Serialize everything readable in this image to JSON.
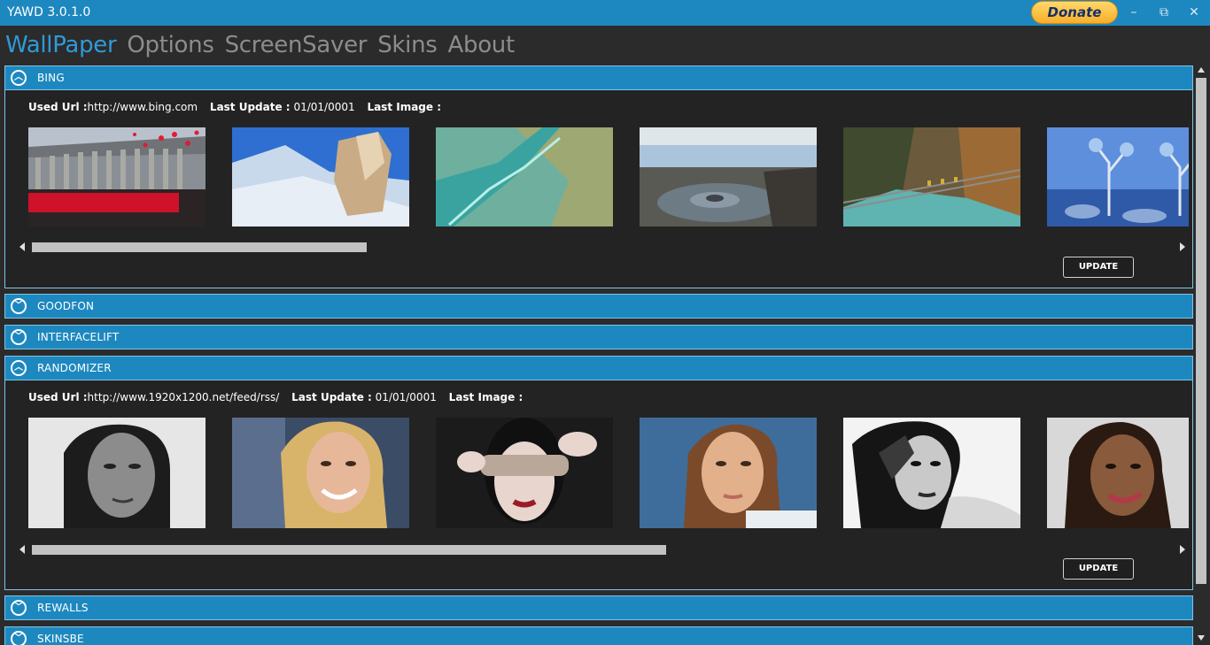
{
  "window": {
    "title": "YAWD 3.0.1.0",
    "donate_label": "Donate",
    "minimize": "–",
    "restore": "⧉",
    "close": "✕"
  },
  "nav": {
    "items": [
      "WallPaper",
      "Options",
      "ScreenSaver",
      "Skins",
      "About"
    ],
    "active": "WallPaper"
  },
  "labels": {
    "used_url": "Used Url :",
    "last_update": "Last Update :",
    "last_image": "Last Image :",
    "update": "UPDATE"
  },
  "panels": [
    {
      "name": "BING",
      "expanded": true,
      "url": "http://www.bing.com",
      "last_update": "01/01/0001",
      "scroll_fraction": 0.29,
      "thumbnails": [
        "cathedral-crowd-balloons",
        "snowy-mountain-rock",
        "aerial-river-delta",
        "mud-volcano-landscape",
        "rope-bridge-autumn-gorge",
        "blue-tinted-trees"
      ]
    },
    {
      "name": "GOODFON",
      "expanded": false
    },
    {
      "name": "INTERFACELIFT",
      "expanded": false
    },
    {
      "name": "RANDOMIZER",
      "expanded": true,
      "url": "http://www.1920x1200.net/feed/rss/",
      "last_update": "01/01/0001",
      "scroll_fraction": 0.54,
      "thumbnails": [
        "bw-portrait-woman",
        "smiling-blonde-woman",
        "woman-eye-mask",
        "woman-portrait-blue",
        "bw-woman-hand",
        "smiling-woman-portrait"
      ]
    },
    {
      "name": "REWALLS",
      "expanded": false
    },
    {
      "name": "SKINSBE",
      "expanded": false
    }
  ],
  "colors": {
    "accent": "#1d88bf",
    "nav_active": "#2e9ad8",
    "nav_inactive": "#8c8c8c",
    "background": "#2b2b2b",
    "panel_body": "#232323"
  },
  "icons": {
    "collapse": "chevron-up-icon",
    "expand": "chevron-down-icon"
  }
}
